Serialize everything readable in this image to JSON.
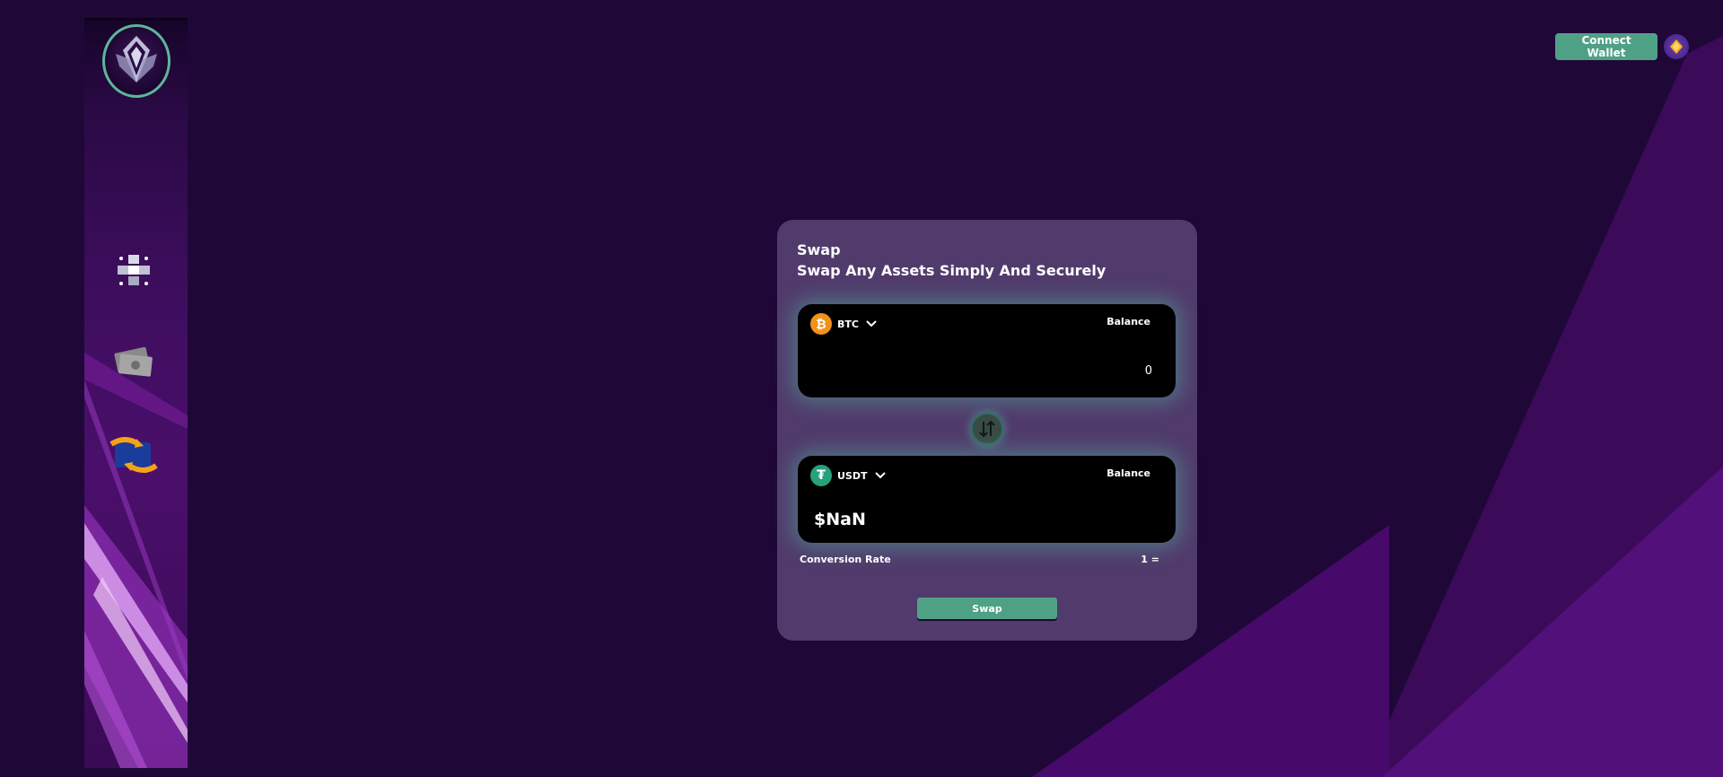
{
  "header": {
    "connect_wallet_label": "Connect Wallet"
  },
  "sidebar": {
    "items": [
      {
        "name": "dashboard",
        "icon": "blocks-icon"
      },
      {
        "name": "cash",
        "icon": "money-icon"
      },
      {
        "name": "swap",
        "icon": "exchange-icon"
      }
    ]
  },
  "swap": {
    "title": "Swap",
    "subtitle": "Swap Any Assets Simply And Securely",
    "from": {
      "symbol": "BTC",
      "balance_label": "Balance",
      "amount": "0"
    },
    "to": {
      "symbol": "USDT",
      "balance_label": "Balance",
      "usd_value": "$NaN"
    },
    "conversion_rate_label": "Conversion Rate",
    "conversion_rate_value": "1 =",
    "swap_button_label": "Swap"
  },
  "colors": {
    "accent": "#4fa186",
    "background": "#1f0838",
    "card": "#513b6c",
    "btc": "#f0911a",
    "usdt": "#26a17b"
  }
}
